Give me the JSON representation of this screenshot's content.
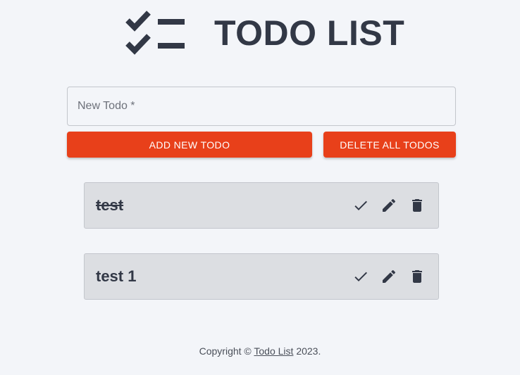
{
  "header": {
    "title": "TODO LIST",
    "logo_icon": "checklist-icon"
  },
  "form": {
    "input_placeholder": "New Todo *",
    "input_value": "",
    "add_label": "ADD NEW TODO",
    "delete_all_label": "DELETE ALL TODOS"
  },
  "todos": [
    {
      "text": "test",
      "completed": true
    },
    {
      "text": "test 1",
      "completed": false
    }
  ],
  "item_actions": {
    "complete_icon": "check-icon",
    "edit_icon": "pencil-icon",
    "delete_icon": "trash-icon"
  },
  "footer": {
    "prefix": "Copyright © ",
    "link_text": "Todo List",
    "suffix": " 2023."
  },
  "colors": {
    "accent": "#e8401a",
    "text": "#323846",
    "item_bg": "#dcdee2",
    "page_bg": "#f3f5f9"
  }
}
